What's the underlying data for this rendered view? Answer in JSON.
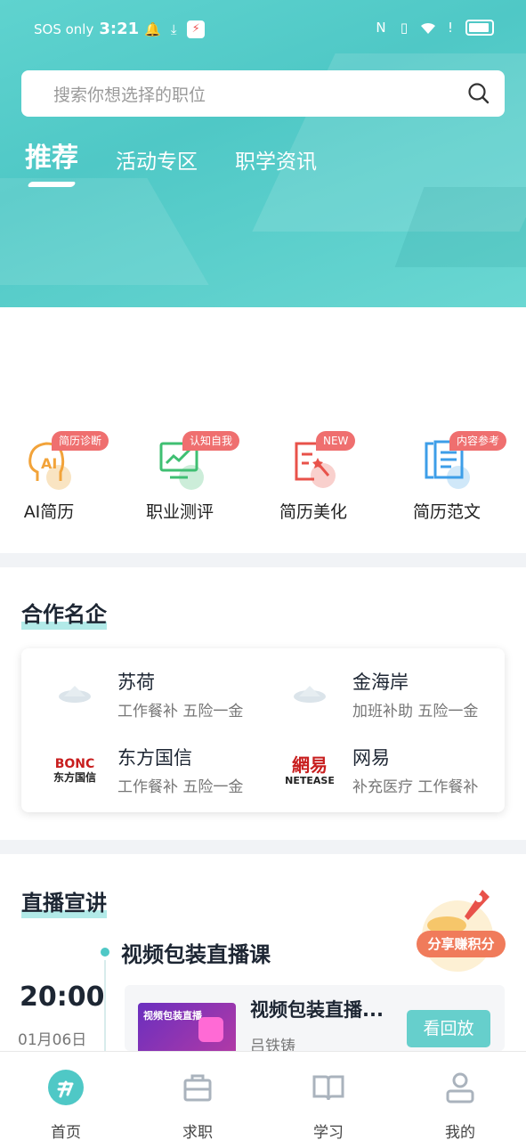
{
  "status_bar": {
    "carrier": "SOS only",
    "time": "3:21"
  },
  "search": {
    "placeholder": "搜索你想选择的职位"
  },
  "tabs": [
    {
      "label": "推荐",
      "active": true
    },
    {
      "label": "活动专区",
      "active": false
    },
    {
      "label": "职学资讯",
      "active": false
    }
  ],
  "quick_actions": [
    {
      "label": "AI简历",
      "badge": "简历诊断",
      "icon": "ai-resume-icon",
      "color": "#f2a33a"
    },
    {
      "label": "职业测评",
      "badge": "认知自我",
      "icon": "career-test-icon",
      "color": "#3fbf72"
    },
    {
      "label": "简历美化",
      "badge": "NEW",
      "icon": "resume-beautify-icon",
      "color": "#e8524a"
    },
    {
      "label": "简历范文",
      "badge": "内容参考",
      "icon": "resume-sample-icon",
      "color": "#3d9ee8"
    }
  ],
  "partners": {
    "title": "合作名企",
    "items": [
      {
        "name": "苏荷",
        "tags": "工作餐补 五险一金"
      },
      {
        "name": "金海岸",
        "tags": "加班补助 五险一金"
      },
      {
        "name": "东方国信",
        "tags": "工作餐补 五险一金",
        "logo_text_top": "BONC",
        "logo_text_bottom": "东方国信"
      },
      {
        "name": "网易",
        "tags": "补充医疗 工作餐补",
        "logo_text_top": "網易",
        "logo_text_bottom": "NETEASE"
      }
    ]
  },
  "live": {
    "title": "直播宣讲",
    "promo": "分享赚积分",
    "heading": "视频包装直播课",
    "time": "20:00",
    "date": "01月06日",
    "card_title": "视频包装直播...",
    "author": "吕铁铸",
    "thumb_text": "视频包装直播",
    "replay_label": "看回放"
  },
  "bottom_nav": [
    {
      "label": "首页",
      "icon": "home-icon",
      "active": true
    },
    {
      "label": "求职",
      "icon": "briefcase-icon",
      "active": false
    },
    {
      "label": "学习",
      "icon": "book-icon",
      "active": false
    },
    {
      "label": "我的",
      "icon": "profile-icon",
      "active": false
    }
  ],
  "colors": {
    "brand": "#4fc8c6",
    "badge": "#ef6f6f"
  }
}
